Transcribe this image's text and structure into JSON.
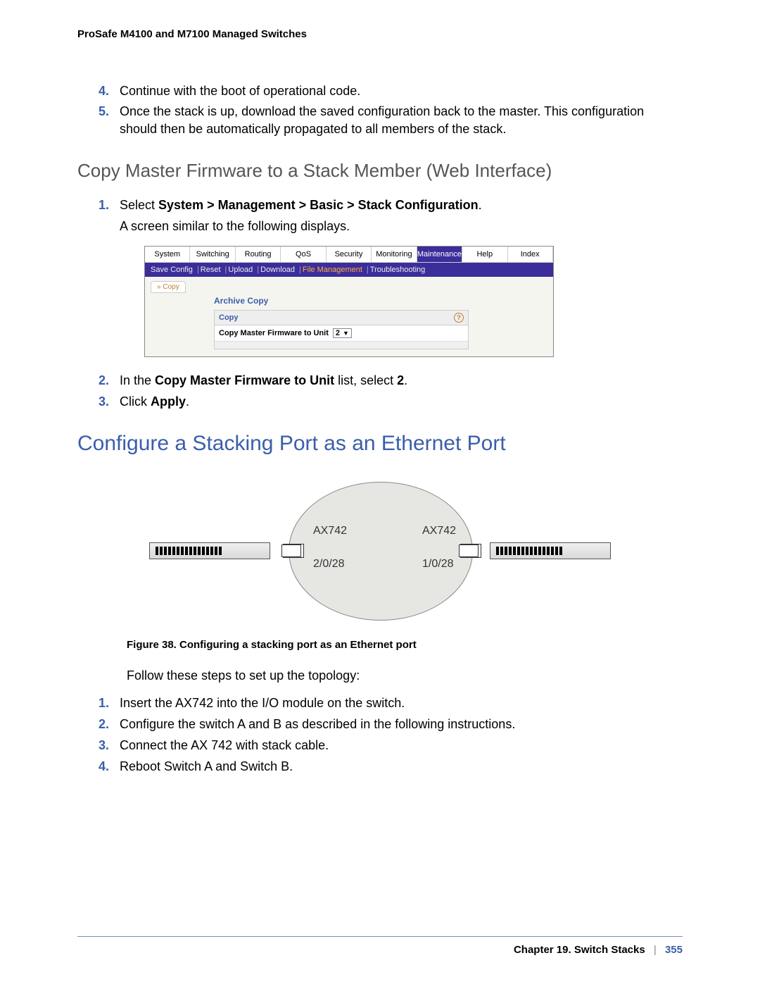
{
  "header": {
    "title": "ProSafe M4100 and M7100 Managed Switches"
  },
  "cont_steps": [
    {
      "num": "4.",
      "text": "Continue with the boot of operational code."
    },
    {
      "num": "5.",
      "text": "Once the stack is up, download the saved configuration back to the master. This configuration should then be automatically propagated to all members of the stack."
    }
  ],
  "section1": {
    "title": "Copy Master Firmware to a Stack Member (Web Interface)",
    "step1_prefix": "Select ",
    "step1_bold": "System > Management > Basic > Stack Configuration",
    "step1_suffix": ".",
    "step1_follow": "A screen similar to the following displays."
  },
  "ui": {
    "tabs": [
      "System",
      "Switching",
      "Routing",
      "QoS",
      "Security",
      "Monitoring",
      "Maintenance",
      "Help",
      "Index"
    ],
    "active_tab": "Maintenance",
    "subbar": {
      "items": [
        "Save Config",
        "Reset",
        "Upload",
        "Download",
        "File Management",
        "Troubleshooting"
      ],
      "active": "File Management"
    },
    "side_tab": "Copy",
    "section_title": "Archive Copy",
    "panel_title": "Copy",
    "field_label": "Copy Master Firmware to Unit",
    "field_value": "2"
  },
  "section1b": {
    "step2_prefix": "In the ",
    "step2_bold": "Copy Master Firmware to Unit",
    "step2_mid": " list, select ",
    "step2_val": "2",
    "step2_suffix": ".",
    "step3_prefix": "Click ",
    "step3_bold": "Apply",
    "step3_suffix": "."
  },
  "section2": {
    "title": "Configure a Stacking Port as an Ethernet Port",
    "diagram": {
      "ax_left": "AX742",
      "ax_right": "AX742",
      "port_left": "2/0/28",
      "port_right": "1/0/28"
    },
    "fig_caption": "Figure 38. Configuring a stacking port as an Ethernet port",
    "intro": "Follow these steps to set up the topology:",
    "steps": [
      {
        "num": "1.",
        "text": "Insert the AX742 into the I/O module on the switch."
      },
      {
        "num": "2.",
        "text": "Configure the switch A and B as described in the following instructions."
      },
      {
        "num": "3.",
        "text": "Connect the AX 742 with stack cable."
      },
      {
        "num": "4.",
        "text": "Reboot Switch A and Switch B."
      }
    ]
  },
  "footer": {
    "chapter": "Chapter 19.  Switch Stacks",
    "page": "355"
  }
}
